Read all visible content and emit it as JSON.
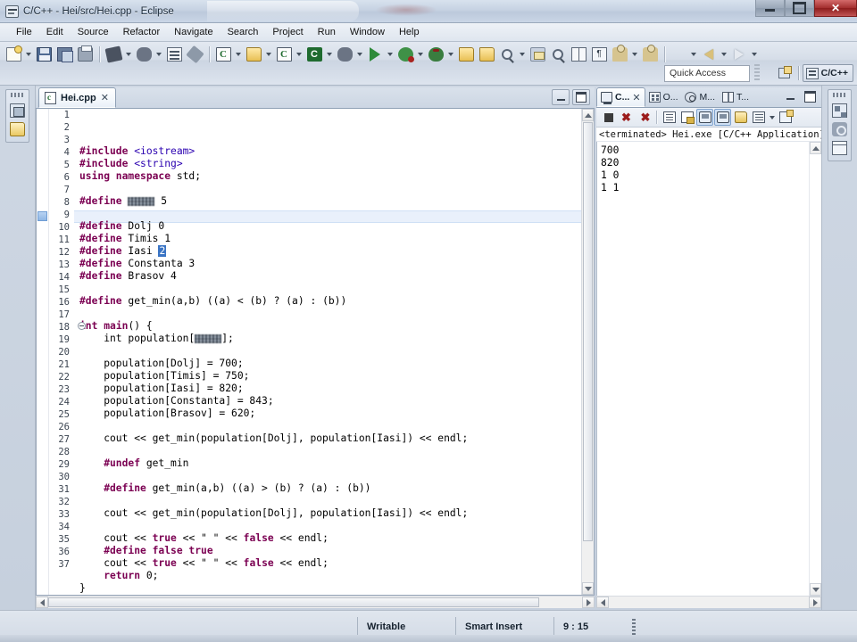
{
  "window": {
    "title": "C/C++ - Hei/src/Hei.cpp - Eclipse",
    "icon": "eclipse-icon",
    "minimize_label": "Minimize",
    "maximize_label": "Maximize",
    "close_label": "Close"
  },
  "menubar": {
    "items": [
      {
        "label": "File"
      },
      {
        "label": "Edit"
      },
      {
        "label": "Source"
      },
      {
        "label": "Refactor"
      },
      {
        "label": "Navigate"
      },
      {
        "label": "Search"
      },
      {
        "label": "Project"
      },
      {
        "label": "Run"
      },
      {
        "label": "Window"
      },
      {
        "label": "Help"
      }
    ]
  },
  "toolbar": {
    "quick_access_placeholder": "Quick Access",
    "quick_access_value": "",
    "perspective_label": "C/C++",
    "open_perspective_tooltip": "Open Perspective",
    "icons": [
      "new-file-icon",
      "new-dropdown-icon",
      "save-icon",
      "save-all-icon",
      "print-icon",
      "build-all-icon",
      "build-dropdown-icon",
      "build-clean-icon",
      "build-config-dropdown-icon",
      "new-cpp-class-icon",
      "search-icon",
      "new-c-project-icon",
      "new-c-dropdown-icon",
      "new-cpp-file-icon",
      "new-cpp-dropdown-icon",
      "open-element-icon",
      "open-dropdown-icon",
      "c-index-icon",
      "c-index-dropdown-icon",
      "external-tools-icon",
      "external-dropdown-icon",
      "run-icon",
      "run-dropdown-icon",
      "debug-icon",
      "debug-dropdown-icon",
      "profile-icon",
      "profile-dropdown-icon",
      "open-folder-icon",
      "open-type-icon",
      "skip-breakpoints-icon",
      "toggle-mark-icon",
      "toggle-block-icon",
      "show-whitespace-icon",
      "next-annotation-icon",
      "previous-annotation-icon",
      "person-icon",
      "person-dropdown-icon",
      "back-icon",
      "back-dropdown-icon",
      "forward-icon",
      "forward-dropdown-icon",
      "last-edit-icon",
      "last-edit-dropdown-icon"
    ]
  },
  "left_fast_view": {
    "icons": [
      "project-explorer-icon",
      "folder-icon"
    ]
  },
  "right_fast_view": {
    "icons": [
      "hierarchy-icon",
      "snapshot-icon",
      "window-icon"
    ]
  },
  "editor": {
    "tab": {
      "label": "Hei.cpp",
      "file_icon": "cpp-file-icon",
      "close_icon": "close-icon"
    },
    "minimize_label": "Minimize",
    "maximize_label": "Maximize",
    "current_line": 9,
    "lines": [
      {
        "n": 1,
        "tokens": [
          {
            "t": "#include ",
            "c": "kw"
          },
          {
            "t": "<iostream>",
            "c": "hdr"
          }
        ]
      },
      {
        "n": 2,
        "tokens": [
          {
            "t": "#include ",
            "c": "kw"
          },
          {
            "t": "<string>",
            "c": "hdr"
          }
        ]
      },
      {
        "n": 3,
        "tokens": [
          {
            "t": "using namespace ",
            "c": "kw"
          },
          {
            "t": "std;",
            "c": ""
          }
        ]
      },
      {
        "n": 4,
        "tokens": []
      },
      {
        "n": 5,
        "tokens": [
          {
            "t": "#define ",
            "c": "kw"
          },
          {
            "t": "SIZE",
            "c": "mask"
          },
          {
            "t": " 5",
            "c": ""
          }
        ]
      },
      {
        "n": 6,
        "tokens": []
      },
      {
        "n": 7,
        "tokens": [
          {
            "t": "#define ",
            "c": "kw"
          },
          {
            "t": "Dolj 0",
            "c": ""
          }
        ]
      },
      {
        "n": 8,
        "tokens": [
          {
            "t": "#define ",
            "c": "kw"
          },
          {
            "t": "Timis 1",
            "c": ""
          }
        ]
      },
      {
        "n": 9,
        "tokens": [
          {
            "t": "#define ",
            "c": "kw"
          },
          {
            "t": "Iasi ",
            "c": ""
          },
          {
            "t": "2",
            "c": "sel"
          }
        ]
      },
      {
        "n": 10,
        "tokens": [
          {
            "t": "#define ",
            "c": "kw"
          },
          {
            "t": "Constanta 3",
            "c": ""
          }
        ]
      },
      {
        "n": 11,
        "tokens": [
          {
            "t": "#define ",
            "c": "kw"
          },
          {
            "t": "Brasov 4",
            "c": ""
          }
        ]
      },
      {
        "n": 12,
        "tokens": []
      },
      {
        "n": 13,
        "tokens": [
          {
            "t": "#define ",
            "c": "kw"
          },
          {
            "t": "get_min(a,b) ((a) < (b) ? (a) : (b))",
            "c": ""
          }
        ]
      },
      {
        "n": 14,
        "tokens": []
      },
      {
        "n": 15,
        "tokens": [
          {
            "t": "int ",
            "c": "kwb"
          },
          {
            "t": "main",
            "c": "kwb"
          },
          {
            "t": "() {",
            "c": ""
          }
        ],
        "fold": true
      },
      {
        "n": 16,
        "tokens": [
          {
            "t": "    int population[",
            "c": ""
          },
          {
            "t": "SIZE",
            "c": "mask"
          },
          {
            "t": "];",
            "c": ""
          }
        ]
      },
      {
        "n": 17,
        "tokens": []
      },
      {
        "n": 18,
        "tokens": [
          {
            "t": "    population[Dolj] = 700;",
            "c": ""
          }
        ]
      },
      {
        "n": 19,
        "tokens": [
          {
            "t": "    population[Timis] = 750;",
            "c": ""
          }
        ]
      },
      {
        "n": 20,
        "tokens": [
          {
            "t": "    population[Iasi] = 820;",
            "c": ""
          }
        ]
      },
      {
        "n": 21,
        "tokens": [
          {
            "t": "    population[Constanta] = 843;",
            "c": ""
          }
        ]
      },
      {
        "n": 22,
        "tokens": [
          {
            "t": "    population[Brasov] = 620;",
            "c": ""
          }
        ]
      },
      {
        "n": 23,
        "tokens": []
      },
      {
        "n": 24,
        "tokens": [
          {
            "t": "    cout << get_min(population[Dolj], population[Iasi]) << endl;",
            "c": ""
          }
        ]
      },
      {
        "n": 25,
        "tokens": []
      },
      {
        "n": 26,
        "tokens": [
          {
            "t": "    #undef ",
            "c": "kw"
          },
          {
            "t": "get_min",
            "c": ""
          }
        ]
      },
      {
        "n": 27,
        "tokens": []
      },
      {
        "n": 28,
        "tokens": [
          {
            "t": "    #define ",
            "c": "kw"
          },
          {
            "t": "get_min(a,b) ((a) > (b) ? (a) : (b))",
            "c": ""
          }
        ]
      },
      {
        "n": 29,
        "tokens": []
      },
      {
        "n": 30,
        "tokens": [
          {
            "t": "    cout << get_min(population[Dolj], population[Iasi]) << endl;",
            "c": ""
          }
        ]
      },
      {
        "n": 31,
        "tokens": []
      },
      {
        "n": 32,
        "tokens": [
          {
            "t": "    cout << ",
            "c": ""
          },
          {
            "t": "true",
            "c": "kwb"
          },
          {
            "t": " << \" \" << ",
            "c": ""
          },
          {
            "t": "false",
            "c": "kwb"
          },
          {
            "t": " << endl;",
            "c": ""
          }
        ]
      },
      {
        "n": 33,
        "tokens": [
          {
            "t": "    #define ",
            "c": "kw"
          },
          {
            "t": "false true",
            "c": "kwb"
          }
        ]
      },
      {
        "n": 34,
        "tokens": [
          {
            "t": "    cout << ",
            "c": ""
          },
          {
            "t": "true",
            "c": "kwb"
          },
          {
            "t": " << \" \" << ",
            "c": ""
          },
          {
            "t": "false",
            "c": "kwb"
          },
          {
            "t": " << endl;",
            "c": ""
          }
        ]
      },
      {
        "n": 35,
        "tokens": [
          {
            "t": "    return ",
            "c": "kwb"
          },
          {
            "t": "0;",
            "c": ""
          }
        ]
      },
      {
        "n": 36,
        "tokens": [
          {
            "t": "}",
            "c": ""
          }
        ]
      },
      {
        "n": 37,
        "tokens": []
      }
    ]
  },
  "console_view": {
    "tabs": [
      {
        "label": "C...",
        "icon": "console-icon",
        "active": true,
        "close_icon": "close-icon"
      },
      {
        "label": "O...",
        "icon": "outline-icon",
        "active": false
      },
      {
        "label": "M...",
        "icon": "make-target-icon",
        "active": false
      },
      {
        "label": "T...",
        "icon": "tasks-icon",
        "active": false
      }
    ],
    "minimize_label": "Minimize",
    "maximize_label": "Maximize",
    "toolbar_icons": [
      "terminate-icon",
      "remove-launch-icon",
      "remove-all-terminated-icon",
      "clear-console-icon",
      "scroll-lock-icon",
      "show-console-on-output-icon",
      "pin-console-icon",
      "open-console-icon",
      "display-selected-console-icon",
      "display-dropdown-icon",
      "new-console-view-icon"
    ],
    "header": "<terminated> Hei.exe [C/C++ Application] D:\\Eclip",
    "output": [
      "700",
      "820",
      "1 0",
      "1 1"
    ]
  },
  "statusbar": {
    "writable": "Writable",
    "insert_mode": "Smart Insert",
    "position": "9 : 15"
  }
}
